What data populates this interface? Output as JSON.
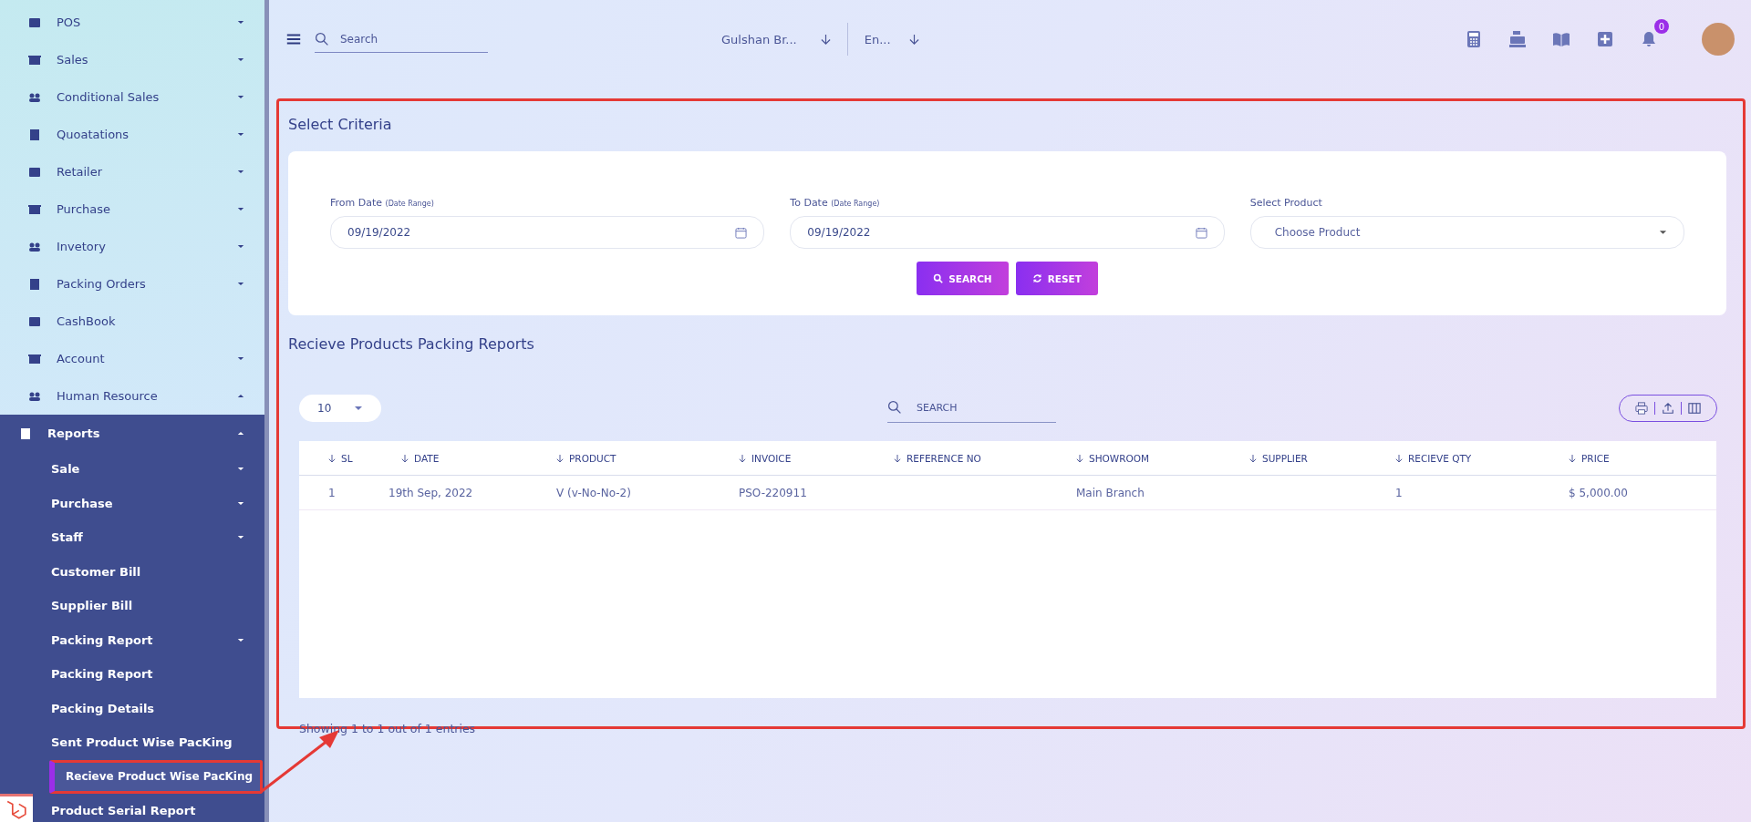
{
  "sidebar": {
    "items": [
      {
        "label": "POS",
        "kind": "menu",
        "expanded": false,
        "selected": false
      },
      {
        "label": "Sales",
        "kind": "menu",
        "expanded": false,
        "selected": false
      },
      {
        "label": "Conditional Sales",
        "kind": "menu",
        "expanded": false,
        "selected": false
      },
      {
        "label": "Quoatations",
        "kind": "menu",
        "expanded": false,
        "selected": false
      },
      {
        "label": "Retailer",
        "kind": "menu",
        "expanded": false,
        "selected": false
      },
      {
        "label": "Purchase",
        "kind": "menu",
        "expanded": false,
        "selected": false
      },
      {
        "label": "Invetory",
        "kind": "menu",
        "expanded": false,
        "selected": false
      },
      {
        "label": "Packing Orders",
        "kind": "menu",
        "expanded": false,
        "selected": false
      },
      {
        "label": "CashBook",
        "kind": "link",
        "selected": false
      },
      {
        "label": "Account",
        "kind": "menu",
        "expanded": false,
        "selected": false
      },
      {
        "label": "Human Resource",
        "kind": "menu",
        "expanded": true,
        "selected": false
      },
      {
        "label": "Reports",
        "kind": "menu",
        "expanded": true,
        "selected": true,
        "children": [
          {
            "label": "Sale",
            "kind": "menu",
            "expanded": false,
            "selected": false
          },
          {
            "label": "Purchase",
            "kind": "menu",
            "expanded": false,
            "selected": false
          },
          {
            "label": "Staff",
            "kind": "menu",
            "expanded": false,
            "selected": false
          },
          {
            "label": "Customer Bill",
            "kind": "link",
            "selected": false
          },
          {
            "label": "Supplier Bill",
            "kind": "link",
            "selected": false
          },
          {
            "label": "Packing Report",
            "kind": "menu",
            "expanded": false,
            "selected": false
          },
          {
            "label": "Packing Report",
            "kind": "link",
            "selected": false
          },
          {
            "label": "Packing Details",
            "kind": "link",
            "selected": false
          },
          {
            "label": "Sent Product Wise PacKing",
            "kind": "link",
            "selected": false
          },
          {
            "label": "Recieve Product Wise PacKing",
            "kind": "link",
            "selected": true
          },
          {
            "label": "Product Serial Report",
            "kind": "link",
            "selected": false
          }
        ]
      }
    ]
  },
  "topbar": {
    "search": {
      "placeholder": "Search"
    },
    "branch": "Gulshan Br...",
    "language": "En...",
    "notifications": "0"
  },
  "criteria": {
    "title": "Select Criteria",
    "fields": [
      {
        "kind": "date",
        "label": "From Date",
        "hint": "(Date Range)",
        "value": "09/19/2022"
      },
      {
        "kind": "date",
        "label": "To Date",
        "hint": "(Date Range)",
        "value": "09/19/2022"
      },
      {
        "kind": "select",
        "label": "Select Product",
        "placeholder": "Choose Product"
      }
    ],
    "buttons": [
      {
        "kind": "search",
        "label": "SEARCH"
      },
      {
        "kind": "reset",
        "label": "RESET"
      }
    ]
  },
  "report": {
    "title": "Recieve Products Packing Reports",
    "page_size": "10",
    "search": {
      "placeholder": "SEARCH"
    },
    "table": {
      "columns": [
        "SL",
        "DATE",
        "PRODUCT",
        "INVOICE",
        "REFERENCE NO",
        "SHOWROOM",
        "SUPPLIER",
        "RECIEVE QTY",
        "PRICE"
      ],
      "rows": [
        [
          "1",
          "19th Sep, 2022",
          "V (v-No-No-2)",
          "PSO-220911",
          "",
          "Main Branch",
          "",
          "1",
          "$ 5,000.00"
        ]
      ]
    },
    "footer": "Showing 1 to 1 out of 1 entries"
  }
}
